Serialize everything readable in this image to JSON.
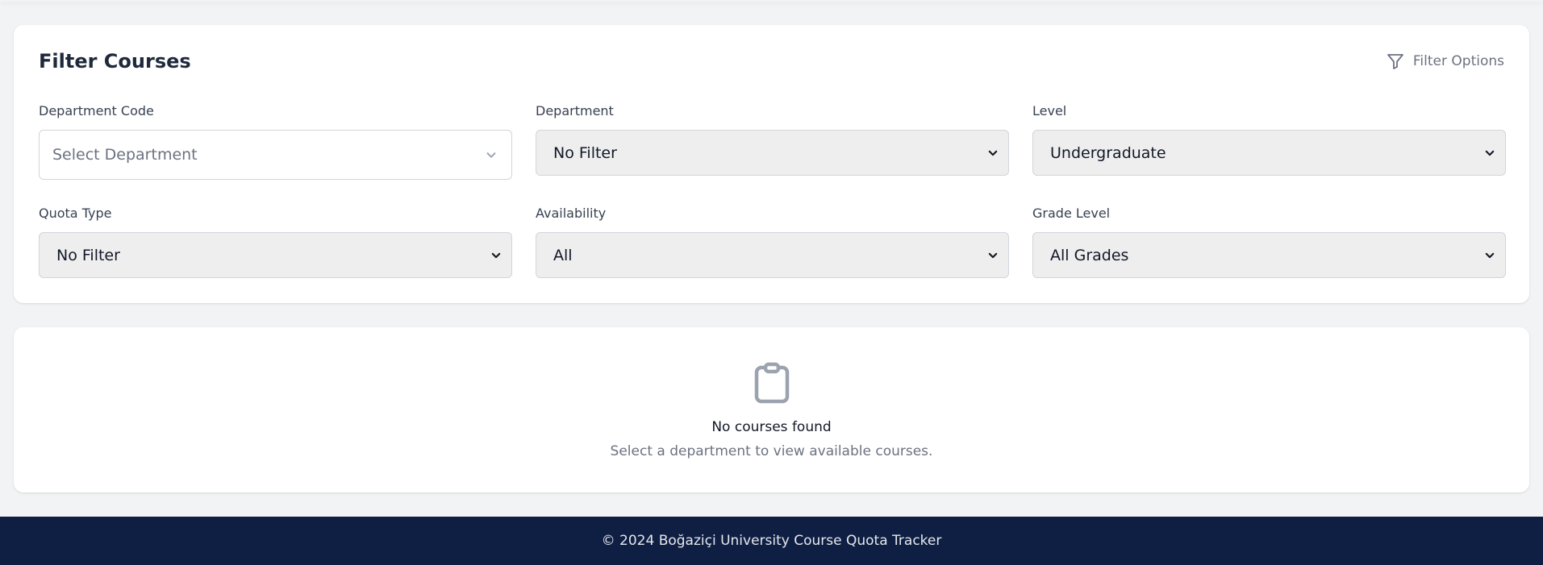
{
  "filter_card": {
    "title": "Filter Courses",
    "filter_options_label": "Filter Options",
    "fields": {
      "department_code": {
        "label": "Department Code",
        "placeholder": "Select Department"
      },
      "department": {
        "label": "Department",
        "value": "No Filter"
      },
      "level": {
        "label": "Level",
        "value": "Undergraduate"
      },
      "quota_type": {
        "label": "Quota Type",
        "value": "No Filter"
      },
      "availability": {
        "label": "Availability",
        "value": "All"
      },
      "grade_level": {
        "label": "Grade Level",
        "value": "All Grades"
      }
    }
  },
  "empty_state": {
    "icon": "clipboard-icon",
    "title": "No courses found",
    "subtitle": "Select a department to view available courses."
  },
  "footer": {
    "text": "© 2024 Boğaziçi University Course Quota Tracker"
  },
  "colors": {
    "background": "#f2f3f5",
    "card": "#ffffff",
    "footer": "#0f1f44",
    "muted_text": "#6b7280",
    "select_bg": "#eeeeee"
  }
}
